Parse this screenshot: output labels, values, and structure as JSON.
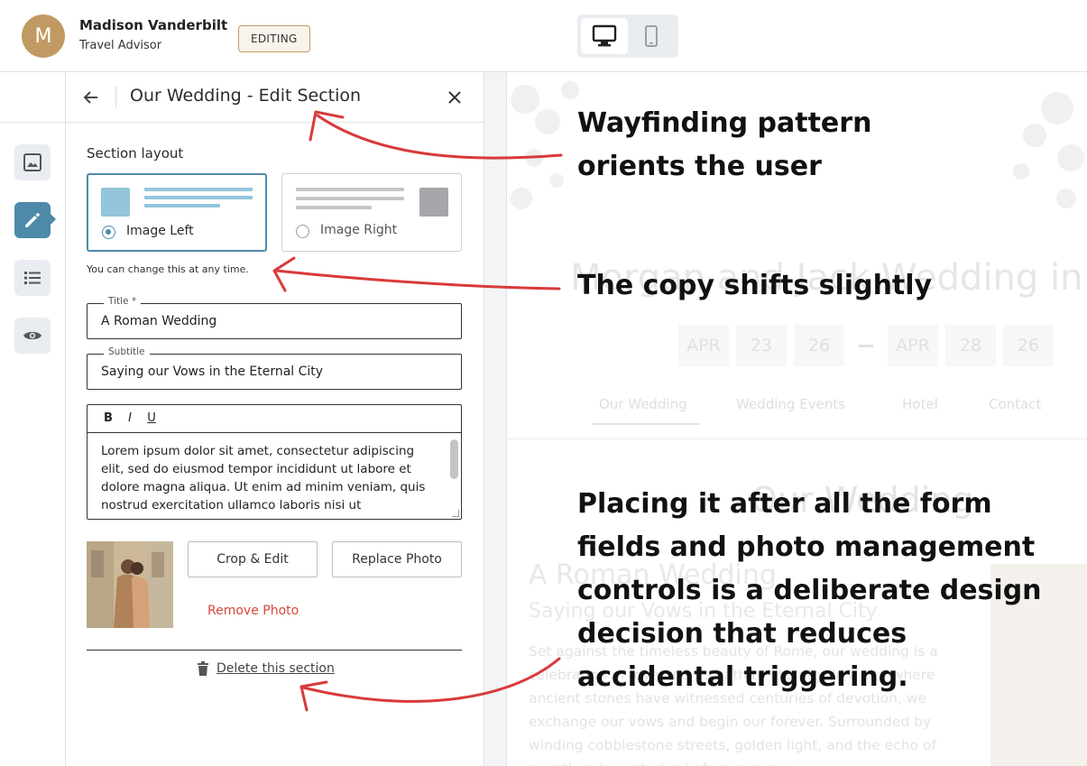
{
  "header": {
    "avatar_initial": "M",
    "user_name": "Madison Vanderbilt",
    "user_role": "Travel Advisor",
    "mode_badge": "EDITING",
    "device_toggle": {
      "active": "desktop",
      "icons": [
        "desktop-icon",
        "mobile-icon"
      ]
    }
  },
  "rail": {
    "items": [
      {
        "icon": "image-icon",
        "active": false
      },
      {
        "icon": "pencil-icon",
        "active": true
      },
      {
        "icon": "list-icon",
        "active": false
      },
      {
        "icon": "eye-icon",
        "active": false
      }
    ]
  },
  "panel": {
    "title": "Our Wedding - Edit Section",
    "section_layout_label": "Section layout",
    "layout_options": [
      {
        "label": "Image Left",
        "selected": true
      },
      {
        "label": "Image Right",
        "selected": false
      }
    ],
    "layout_hint": "You can change this at any time.",
    "title_field": {
      "label": "Title *",
      "value": "A Roman Wedding"
    },
    "subtitle_field": {
      "label": "Subtitle",
      "value": "Saying our Vows in the Eternal City"
    },
    "editor": {
      "toolbar": [
        "B",
        "I",
        "U"
      ],
      "body": "Lorem ipsum dolor sit amet, consectetur adipiscing elit, sed do eiusmod tempor incididunt ut labore et dolore magna aliqua. Ut enim ad minim veniam, quis nostrud exercitation ullamco laboris nisi ut"
    },
    "crop_button": "Crop & Edit",
    "replace_button": "Replace Photo",
    "remove_photo": "Remove Photo",
    "delete_section": "Delete this section"
  },
  "preview": {
    "hero_title": "Morgan and Jack Wedding in",
    "dates": [
      "APR",
      "23",
      "26",
      "APR",
      "28",
      "26"
    ],
    "nav": [
      "Our Wedding",
      "Wedding Events",
      "Hotel",
      "Contact"
    ],
    "section_heading": "Our Wedding",
    "title": "A Roman Wedding",
    "subtitle": "Saying our Vows in the Eternal City",
    "body": "Set against the timeless beauty of Rome, our wedding is a celebration of love and its path to eternity. In a city where ancient stones have witnessed centuries of devotion, we exchange our vows and begin our forever. Surrounded by winding cobblestone streets, golden light, and the echo of countless love stories before ours we"
  },
  "annotations": [
    "Wayfinding pattern orients the user",
    "The copy shifts slightly",
    "Placing it after all the form fields and photo management controls is a deliberate design decision that reduces accidental triggering."
  ],
  "colors": {
    "accent": "#4d8aa9",
    "brand": "#c19a63",
    "danger": "#d9463a",
    "annotation_arrow": "#d93a3a"
  }
}
